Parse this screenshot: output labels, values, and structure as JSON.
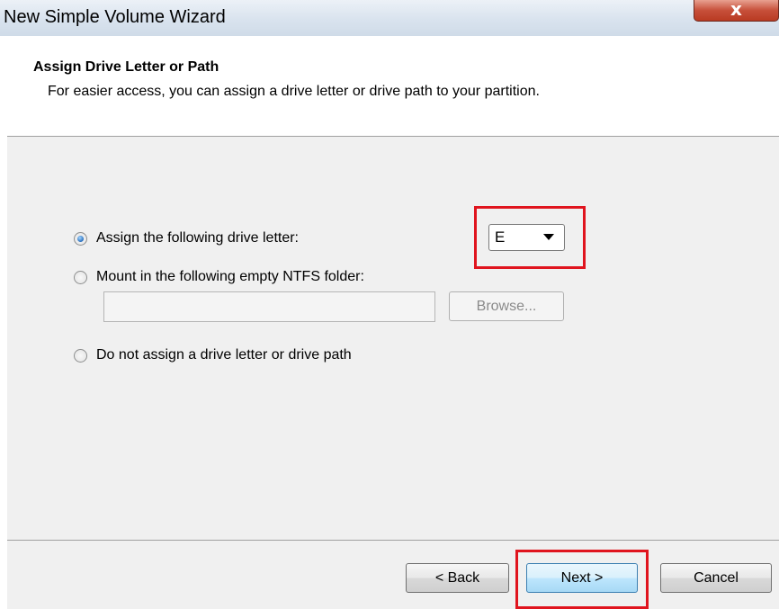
{
  "window": {
    "title": "New Simple Volume Wizard",
    "close_glyph": "x"
  },
  "header": {
    "title": "Assign Drive Letter or Path",
    "subtitle": "For easier access, you can assign a drive letter or drive path to your partition."
  },
  "options": {
    "assign_letter": {
      "label": "Assign the following drive letter:",
      "selected": true
    },
    "mount_folder": {
      "label": "Mount in the following empty NTFS folder:",
      "selected": false
    },
    "no_assign": {
      "label": "Do not assign a drive letter or drive path",
      "selected": false
    }
  },
  "drive_letter": {
    "value": "E",
    "icon": "chevron-down-icon"
  },
  "folder_path": {
    "value": ""
  },
  "buttons": {
    "browse": "Browse...",
    "back": "< Back",
    "next": "Next >",
    "cancel": "Cancel"
  },
  "colors": {
    "highlight": "#e0141e",
    "panel": "#f0f0f0",
    "default_button": "#bee6fd"
  }
}
